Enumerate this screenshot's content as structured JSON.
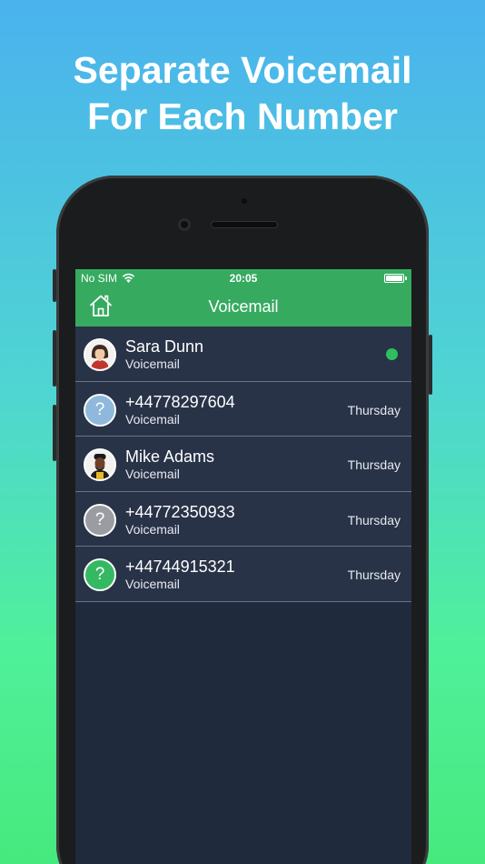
{
  "headline": {
    "line1": "Separate Voicemail",
    "line2": "For Each Number"
  },
  "status_bar": {
    "carrier": "No SIM",
    "time": "20:05",
    "wifi_icon": "wifi-icon",
    "battery_icon": "battery-icon"
  },
  "nav": {
    "title": "Voicemail",
    "home_icon": "home-icon"
  },
  "colors": {
    "accent": "#36ab60",
    "list_bg": "#283347",
    "screen_bg": "#202a3d",
    "unread_dot": "#2fbf5e"
  },
  "voicemails": [
    {
      "name": "Sara Dunn",
      "subtitle": "Voicemail",
      "time": "",
      "avatar": "woman-avatar",
      "unread": true
    },
    {
      "name": "+44778297604",
      "subtitle": "Voicemail",
      "time": "Thursday",
      "avatar": "unknown-avatar",
      "avatar_color": "#8fb8dc",
      "glyph": "?"
    },
    {
      "name": "Mike Adams",
      "subtitle": "Voicemail",
      "time": "Thursday",
      "avatar": "man-avatar"
    },
    {
      "name": "+44772350933",
      "subtitle": "Voicemail",
      "time": "Thursday",
      "avatar": "unknown-avatar",
      "avatar_color": "#9a9ca2",
      "glyph": "?"
    },
    {
      "name": "+44744915321",
      "subtitle": "Voicemail",
      "time": "Thursday",
      "avatar": "unknown-avatar",
      "avatar_color": "#35b862",
      "glyph": "?"
    }
  ]
}
